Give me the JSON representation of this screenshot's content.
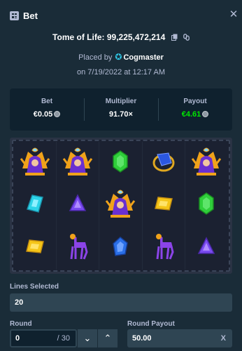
{
  "header": {
    "title": "Bet",
    "close_icon": "close-icon"
  },
  "bet": {
    "game_name": "Tome of Life",
    "bet_id": "99,225,472,214",
    "placed_by_prefix": "Placed by",
    "user": "Cogmaster",
    "date": "on 7/19/2022 at 12:17 AM"
  },
  "stats": {
    "bet_label": "Bet",
    "bet_value": "€0.05",
    "multiplier_label": "Multiplier",
    "multiplier_value": "91.70×",
    "payout_label": "Payout",
    "payout_value": "€4.61"
  },
  "reels": {
    "rows": [
      [
        "pharaoh",
        "pharaoh",
        "emerald",
        "sapphire-ring",
        "pharaoh"
      ],
      [
        "cyan-gem",
        "purple-gem",
        "pharaoh",
        "gold-gem",
        "emerald"
      ],
      [
        "gold-gem",
        "purple-horse",
        "blue-gem",
        "purple-horse",
        "purple-gem"
      ]
    ]
  },
  "lines": {
    "label": "Lines Selected",
    "value": "20"
  },
  "round": {
    "label": "Round",
    "value": "0",
    "total": "/ 30"
  },
  "round_payout": {
    "label": "Round Payout",
    "value": "50.00",
    "suffix": "X"
  },
  "colors": {
    "background": "#1a2c38",
    "panel": "#0f212e",
    "input": "#2f4553",
    "green": "#00e701",
    "muted": "#b1bad3"
  }
}
